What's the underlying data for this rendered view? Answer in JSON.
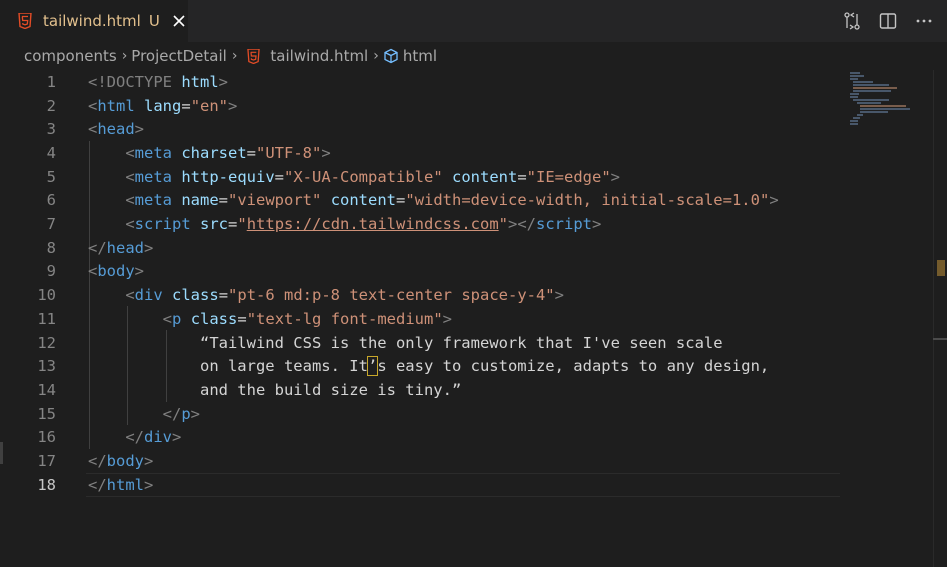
{
  "tab": {
    "label": "tailwind.html",
    "modified_marker": "U"
  },
  "breadcrumb": {
    "items": [
      "components",
      "ProjectDetail",
      "tailwind.html",
      "html"
    ]
  },
  "editor": {
    "active_line": 18,
    "lines": [
      {
        "n": "1"
      },
      {
        "n": "2"
      },
      {
        "n": "3"
      },
      {
        "n": "4"
      },
      {
        "n": "5"
      },
      {
        "n": "6"
      },
      {
        "n": "7"
      },
      {
        "n": "8"
      },
      {
        "n": "9"
      },
      {
        "n": "10"
      },
      {
        "n": "11"
      },
      {
        "n": "12"
      },
      {
        "n": "13"
      },
      {
        "n": "14"
      },
      {
        "n": "15"
      },
      {
        "n": "16"
      },
      {
        "n": "17"
      },
      {
        "n": "18"
      }
    ],
    "tokens": {
      "doctype_open": "<!DOCTYPE",
      "doctype_name": "html",
      "html": "html",
      "lang_attr": "lang",
      "lang_val": "\"en\"",
      "head": "head",
      "meta": "meta",
      "charset_attr": "charset",
      "charset_val": "\"UTF-8\"",
      "httpequiv_attr": "http-equiv",
      "httpequiv_val": "\"X-UA-Compatible\"",
      "content_attr": "content",
      "content_val1": "\"IE=edge\"",
      "name_attr": "name",
      "name_val": "\"viewport\"",
      "content_val2": "\"width=device-width, initial-scale=1.0\"",
      "script": "script",
      "src_attr": "src",
      "src_q1": "\"",
      "src_url": "https://cdn.tailwindcss.com",
      "src_q2": "\"",
      "body": "body",
      "div": "div",
      "class_attr": "class",
      "div_class_val": "\"pt-6 md:p-8 text-center space-y-4\"",
      "p": "p",
      "p_class_val": "\"text-lg font-medium\"",
      "text1": "“Tailwind CSS is the only framework that I've seen scale",
      "text2a": "on large teams. It",
      "text2b": "’",
      "text2c": "s easy to customize, adapts to any design,",
      "text3": "and the build size is tiny.”"
    }
  },
  "icons": {
    "tab_file": "html5-icon",
    "close": "close-icon",
    "compare": "compare-changes-icon",
    "split": "split-editor-icon",
    "more": "more-actions-icon",
    "breadcrumb_file": "html5-icon",
    "breadcrumb_symbol": "symbol-element-icon"
  },
  "colors": {
    "tag": "#569cd6",
    "attr": "#9cdcfe",
    "string": "#ce9178",
    "modified": "#e2c08d",
    "html5": "#e34c26"
  }
}
